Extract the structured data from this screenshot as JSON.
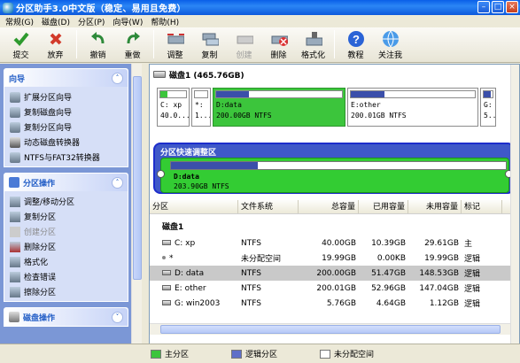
{
  "window": {
    "title": "分区助手3.0中文版（稳定、易用且免费）"
  },
  "menu": [
    "常规(G)",
    "磁盘(D)",
    "分区(P)",
    "向导(W)",
    "帮助(H)"
  ],
  "toolbar": [
    {
      "label": "提交",
      "icon": "check-icon",
      "disabled": false
    },
    {
      "label": "放弃",
      "icon": "cross-icon",
      "disabled": false
    },
    {
      "label": "撤销",
      "icon": "undo-icon",
      "disabled": false
    },
    {
      "label": "重做",
      "icon": "redo-icon",
      "disabled": false
    },
    {
      "label": "调整",
      "icon": "resize-icon",
      "disabled": false
    },
    {
      "label": "复制",
      "icon": "copy-disk-icon",
      "disabled": false
    },
    {
      "label": "创建",
      "icon": "create-icon",
      "disabled": true
    },
    {
      "label": "删除",
      "icon": "delete-icon",
      "disabled": false
    },
    {
      "label": "格式化",
      "icon": "format-icon",
      "disabled": false
    },
    {
      "label": "教程",
      "icon": "help-icon",
      "disabled": false
    },
    {
      "label": "关注我",
      "icon": "globe-icon",
      "disabled": false
    }
  ],
  "sidebar": {
    "wizard": {
      "title": "向导",
      "items": [
        "扩展分区向导",
        "复制磁盘向导",
        "复制分区向导",
        "动态磁盘转换器",
        "NTFS与FAT32转换器"
      ]
    },
    "ops": {
      "title": "分区操作",
      "items": [
        {
          "label": "调整/移动分区",
          "disabled": false
        },
        {
          "label": "复制分区",
          "disabled": false
        },
        {
          "label": "创建分区",
          "disabled": true
        },
        {
          "label": "删除分区",
          "disabled": false
        },
        {
          "label": "格式化",
          "disabled": false
        },
        {
          "label": "检查错误",
          "disabled": false
        },
        {
          "label": "擦除分区",
          "disabled": false
        }
      ]
    },
    "disk_ops": {
      "title": "磁盘操作"
    }
  },
  "disk": {
    "header": "磁盘1 (465.76GB)",
    "blocks": [
      {
        "line1": "C: xp",
        "line2": "40.0...",
        "fill": 0.26
      },
      {
        "line1": "*:",
        "line2": "1...",
        "fill": 0.0
      },
      {
        "line1": "D:data",
        "line2": "200.00GB NTFS",
        "fill": 0.26,
        "selected": true
      },
      {
        "line1": "E:other",
        "line2": "200.01GB NTFS",
        "fill": 0.27
      },
      {
        "line1": "G:",
        "line2": "5...",
        "fill": 0.8
      }
    ]
  },
  "adjust": {
    "title": "分区快速调整区",
    "line1": "D:data",
    "line2": "203.90GB NTFS",
    "fill": 0.26
  },
  "table": {
    "columns": [
      "分区",
      "文件系统",
      "总容量",
      "已用容量",
      "未用容量",
      "标记"
    ],
    "group": "磁盘1",
    "rows": [
      {
        "name": "C:  xp",
        "fs": "NTFS",
        "total": "40.00GB",
        "used": "10.39GB",
        "free": "29.61GB",
        "flag": "主",
        "type": "primary"
      },
      {
        "name": "*",
        "fs": "未分配空间",
        "total": "19.99GB",
        "used": "0.00KB",
        "free": "19.99GB",
        "flag": "逻辑",
        "type": "unalloc"
      },
      {
        "name": "D:  data",
        "fs": "NTFS",
        "total": "200.00GB",
        "used": "51.47GB",
        "free": "148.53GB",
        "flag": "逻辑",
        "type": "logical",
        "selected": true
      },
      {
        "name": "E:  other",
        "fs": "NTFS",
        "total": "200.01GB",
        "used": "52.96GB",
        "free": "147.04GB",
        "flag": "逻辑",
        "type": "logical"
      },
      {
        "name": "G:  win2003",
        "fs": "NTFS",
        "total": "5.76GB",
        "used": "4.64GB",
        "free": "1.12GB",
        "flag": "逻辑",
        "type": "logical"
      }
    ]
  },
  "legend": [
    {
      "label": "主分区",
      "color": "#3CC53C"
    },
    {
      "label": "逻辑分区",
      "color": "#5F6FC8"
    },
    {
      "label": "未分配空间",
      "color": "#FFFFFF"
    }
  ]
}
